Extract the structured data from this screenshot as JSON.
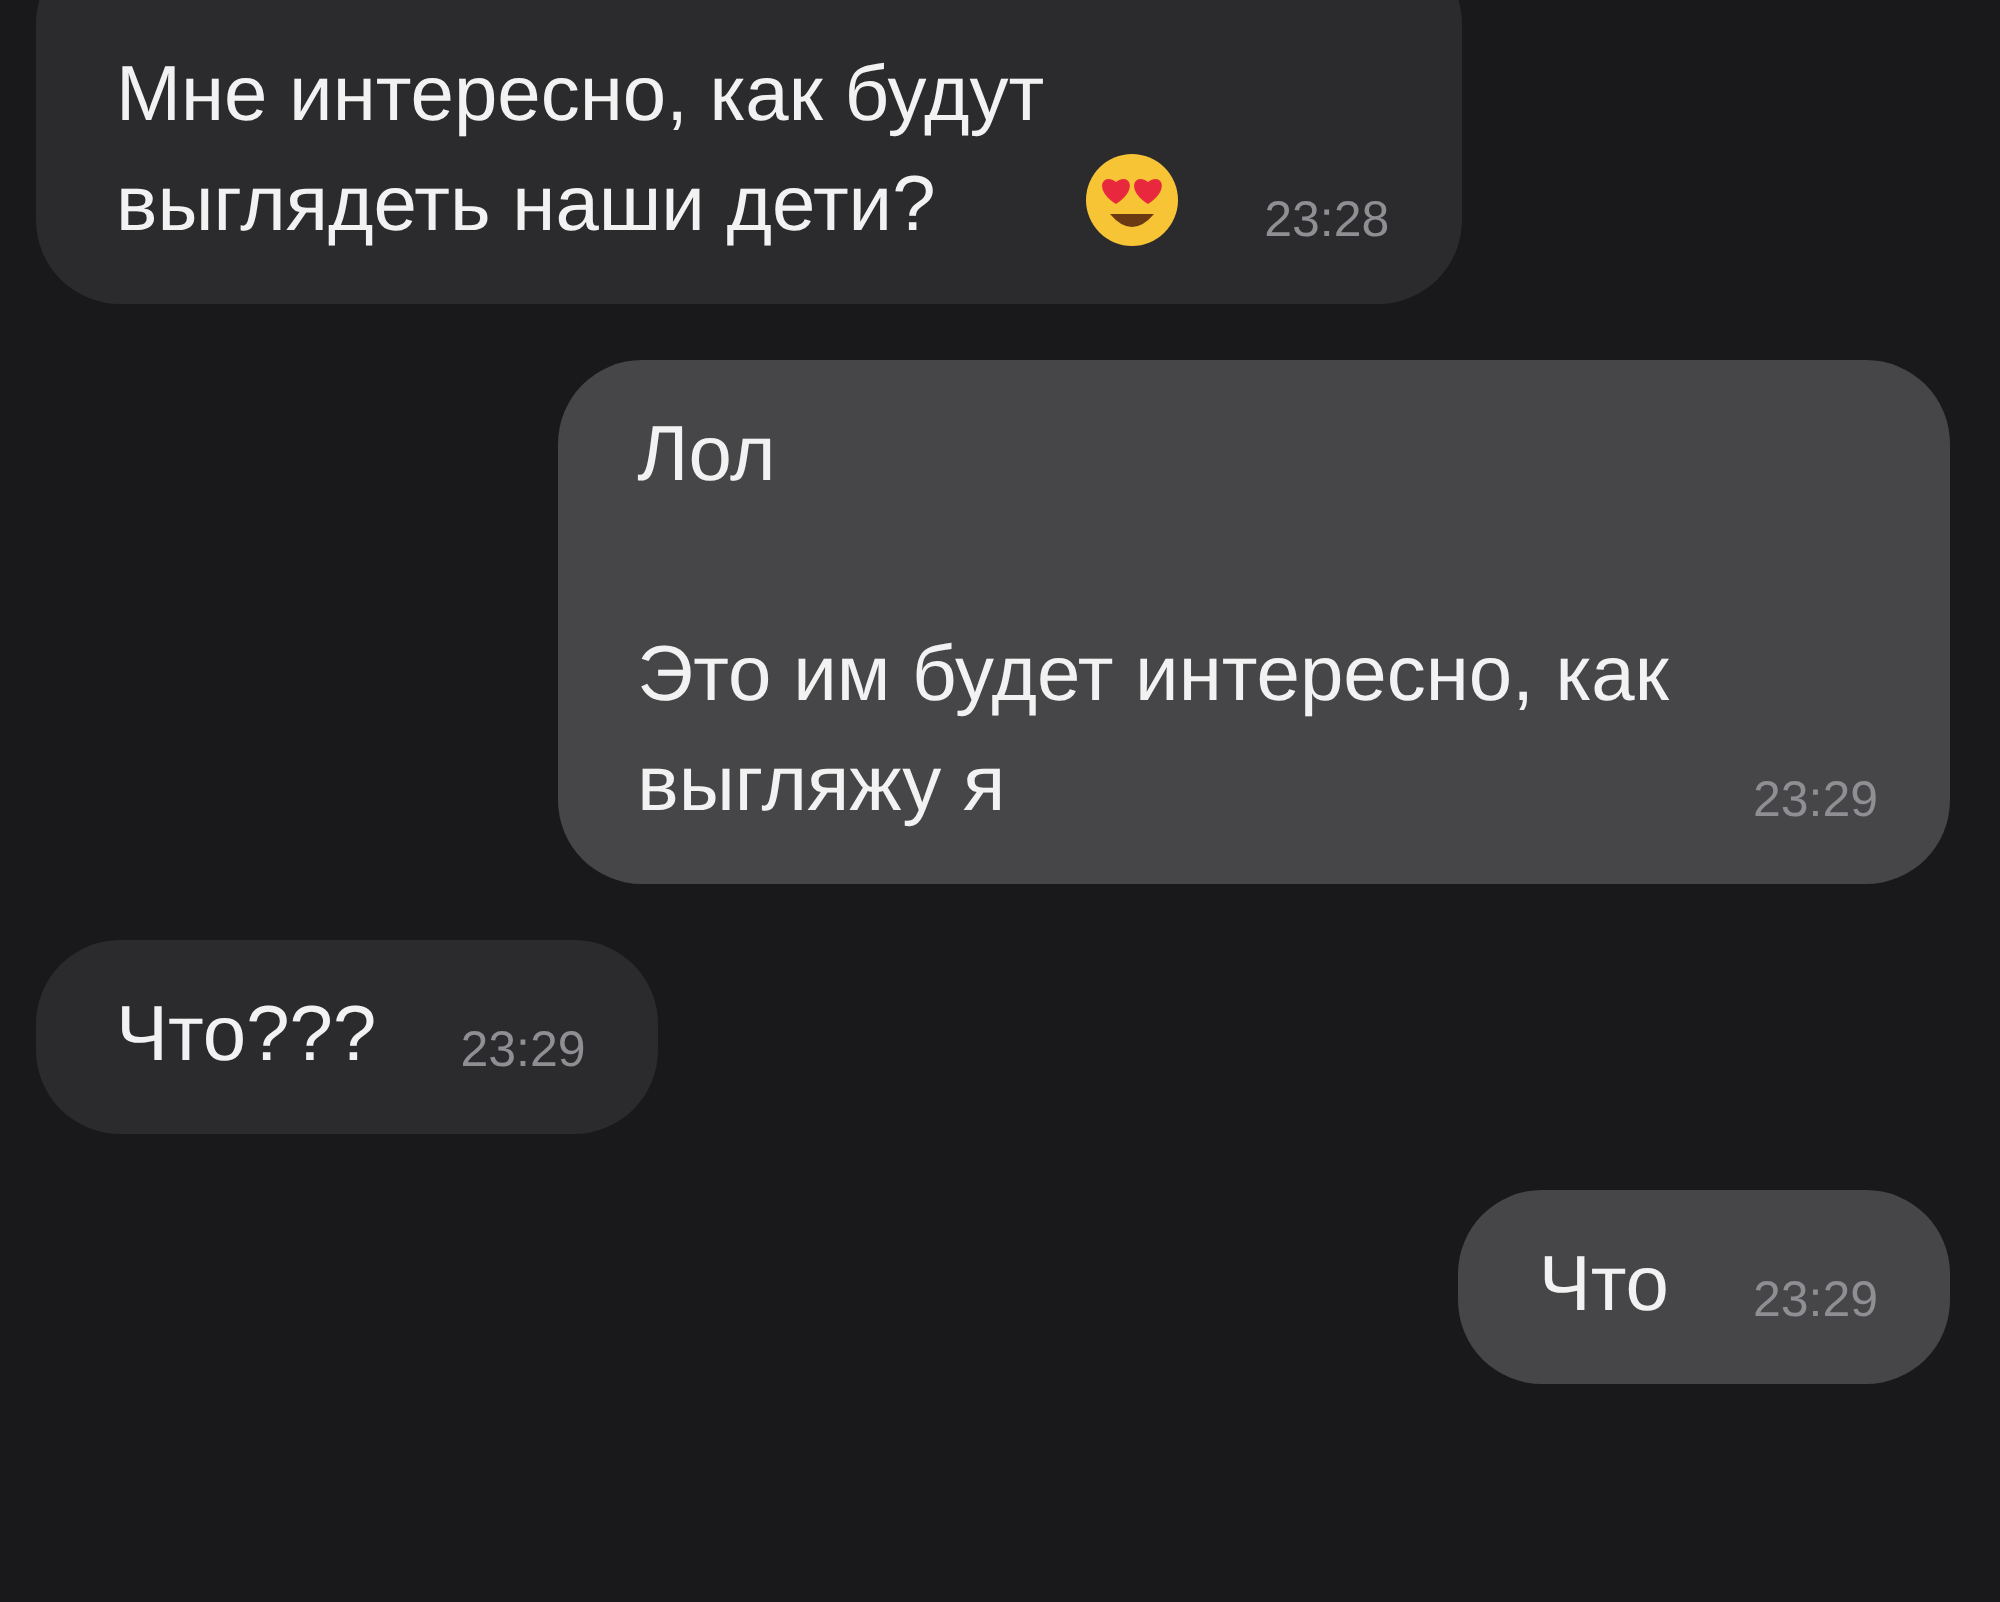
{
  "messages": [
    {
      "kind": "incoming",
      "text": "Мне интересно, как будут\nвыглядеть наши дети?",
      "emoji_icon": true,
      "time": "23:28"
    },
    {
      "kind": "outgoing",
      "text": "Лол\n\nЭто им будет интересно, как\nвыгляжу я",
      "time": "23:29"
    },
    {
      "kind": "incoming",
      "text": "Что???",
      "time": "23:29"
    },
    {
      "kind": "outgoing",
      "text": "Что",
      "time": "23:29"
    }
  ]
}
